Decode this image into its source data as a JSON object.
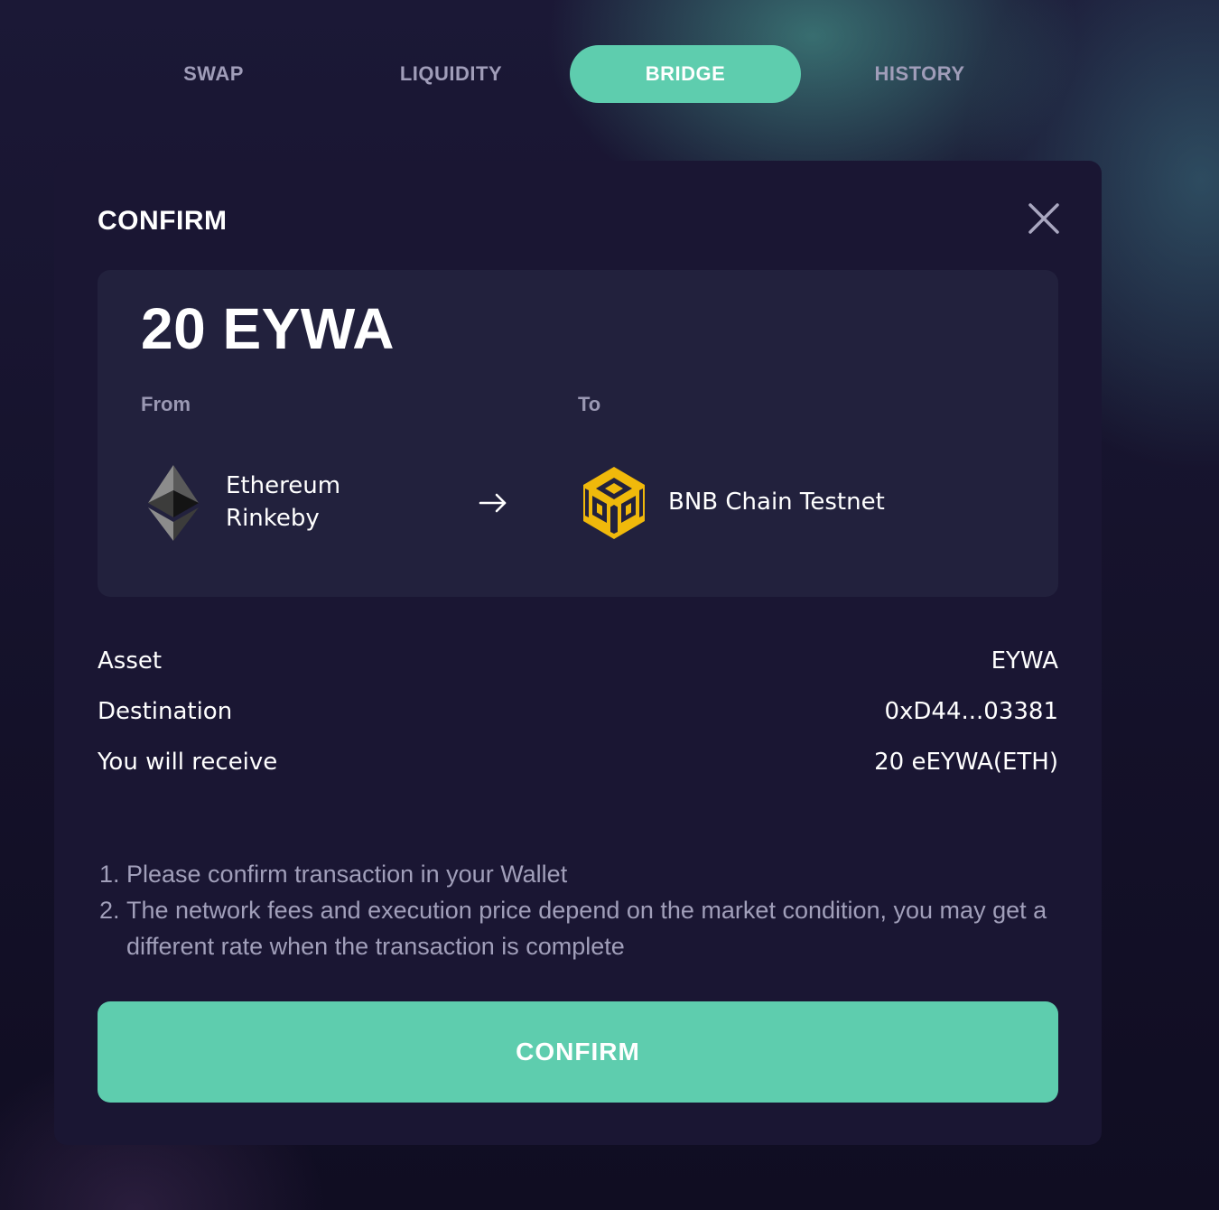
{
  "tabs": [
    {
      "label": "SWAP",
      "active": false
    },
    {
      "label": "LIQUIDITY",
      "active": false
    },
    {
      "label": "BRIDGE",
      "active": true
    },
    {
      "label": "HISTORY",
      "active": false
    }
  ],
  "modal": {
    "title": "CONFIRM",
    "close_icon": "close-icon",
    "amount": "20 EYWA",
    "from": {
      "label": "From",
      "network_line1": "Ethereum",
      "network_line2": "Rinkeby",
      "icon": "ethereum-icon"
    },
    "arrow_icon": "arrow-right-icon",
    "to": {
      "label": "To",
      "network": "BNB Chain Testnet",
      "icon": "bnb-chain-icon"
    },
    "details": [
      {
        "label": "Asset",
        "value": "EYWA"
      },
      {
        "label": "Destination",
        "value": "0xD44...03381"
      },
      {
        "label": "You will receive",
        "value": "20 eEYWA(ETH)"
      }
    ],
    "notes": [
      "Please confirm transaction in your Wallet",
      "The network fees and execution price depend on the market condition, you may get a different rate when the transaction is complete"
    ],
    "confirm_button": "CONFIRM"
  },
  "colors": {
    "accent": "#5ecdae",
    "background": "#15122b",
    "card": "#1a1633",
    "panel": "#22213d",
    "muted_text": "#a09db9",
    "bnb_yellow": "#f0b90b"
  }
}
